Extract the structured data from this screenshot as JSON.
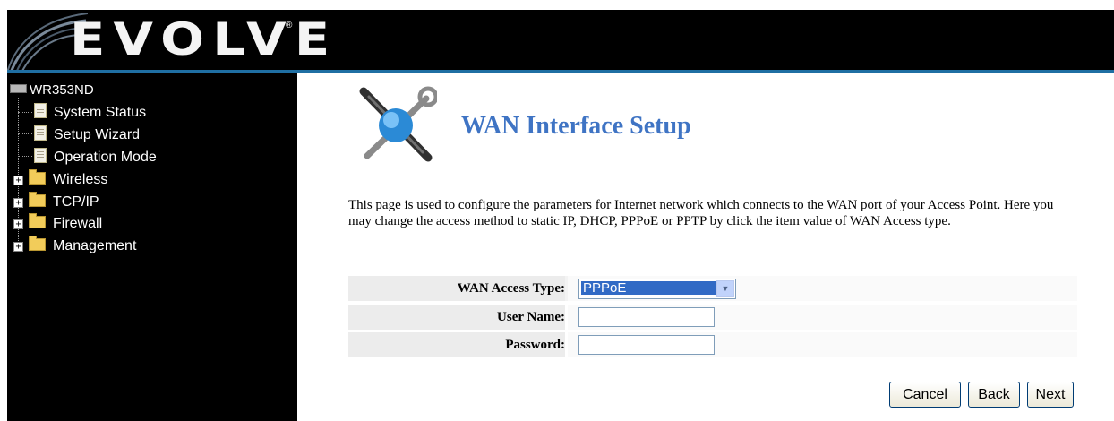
{
  "header": {
    "logo_text": "EVOLVE",
    "logo_mark": "®"
  },
  "sidebar": {
    "root_label": "WR353ND",
    "root_icon": "router-icon",
    "pages": [
      {
        "label": "System Status",
        "icon": "page-icon"
      },
      {
        "label": "Setup Wizard",
        "icon": "page-icon"
      },
      {
        "label": "Operation Mode",
        "icon": "page-icon"
      }
    ],
    "folders": [
      {
        "label": "Wireless",
        "icon": "folder-icon",
        "expander": "+"
      },
      {
        "label": "TCP/IP",
        "icon": "folder-icon",
        "expander": "+"
      },
      {
        "label": "Firewall",
        "icon": "folder-icon",
        "expander": "+"
      },
      {
        "label": "Management",
        "icon": "folder-icon",
        "expander": "+"
      }
    ]
  },
  "main": {
    "title": "WAN Interface Setup",
    "title_icon": "tools-icon",
    "description": "This page is used to configure the parameters for Internet network which connects to the WAN port of your Access Point. Here you may change the access method to static IP, DHCP, PPPoE or PPTP by click the item value of WAN Access type.",
    "form": {
      "wan_access_type_label": "WAN Access Type:",
      "wan_access_type_value": "PPPoE",
      "user_name_label": "User Name:",
      "user_name_value": "",
      "password_label": "Password:",
      "password_value": ""
    },
    "buttons": {
      "cancel": "Cancel",
      "back": "Back",
      "next": "Next"
    }
  },
  "colors": {
    "title": "#3f74c4",
    "header_bg": "#000000",
    "header_line": "#1f6fa3",
    "selection": "#316ac5"
  }
}
